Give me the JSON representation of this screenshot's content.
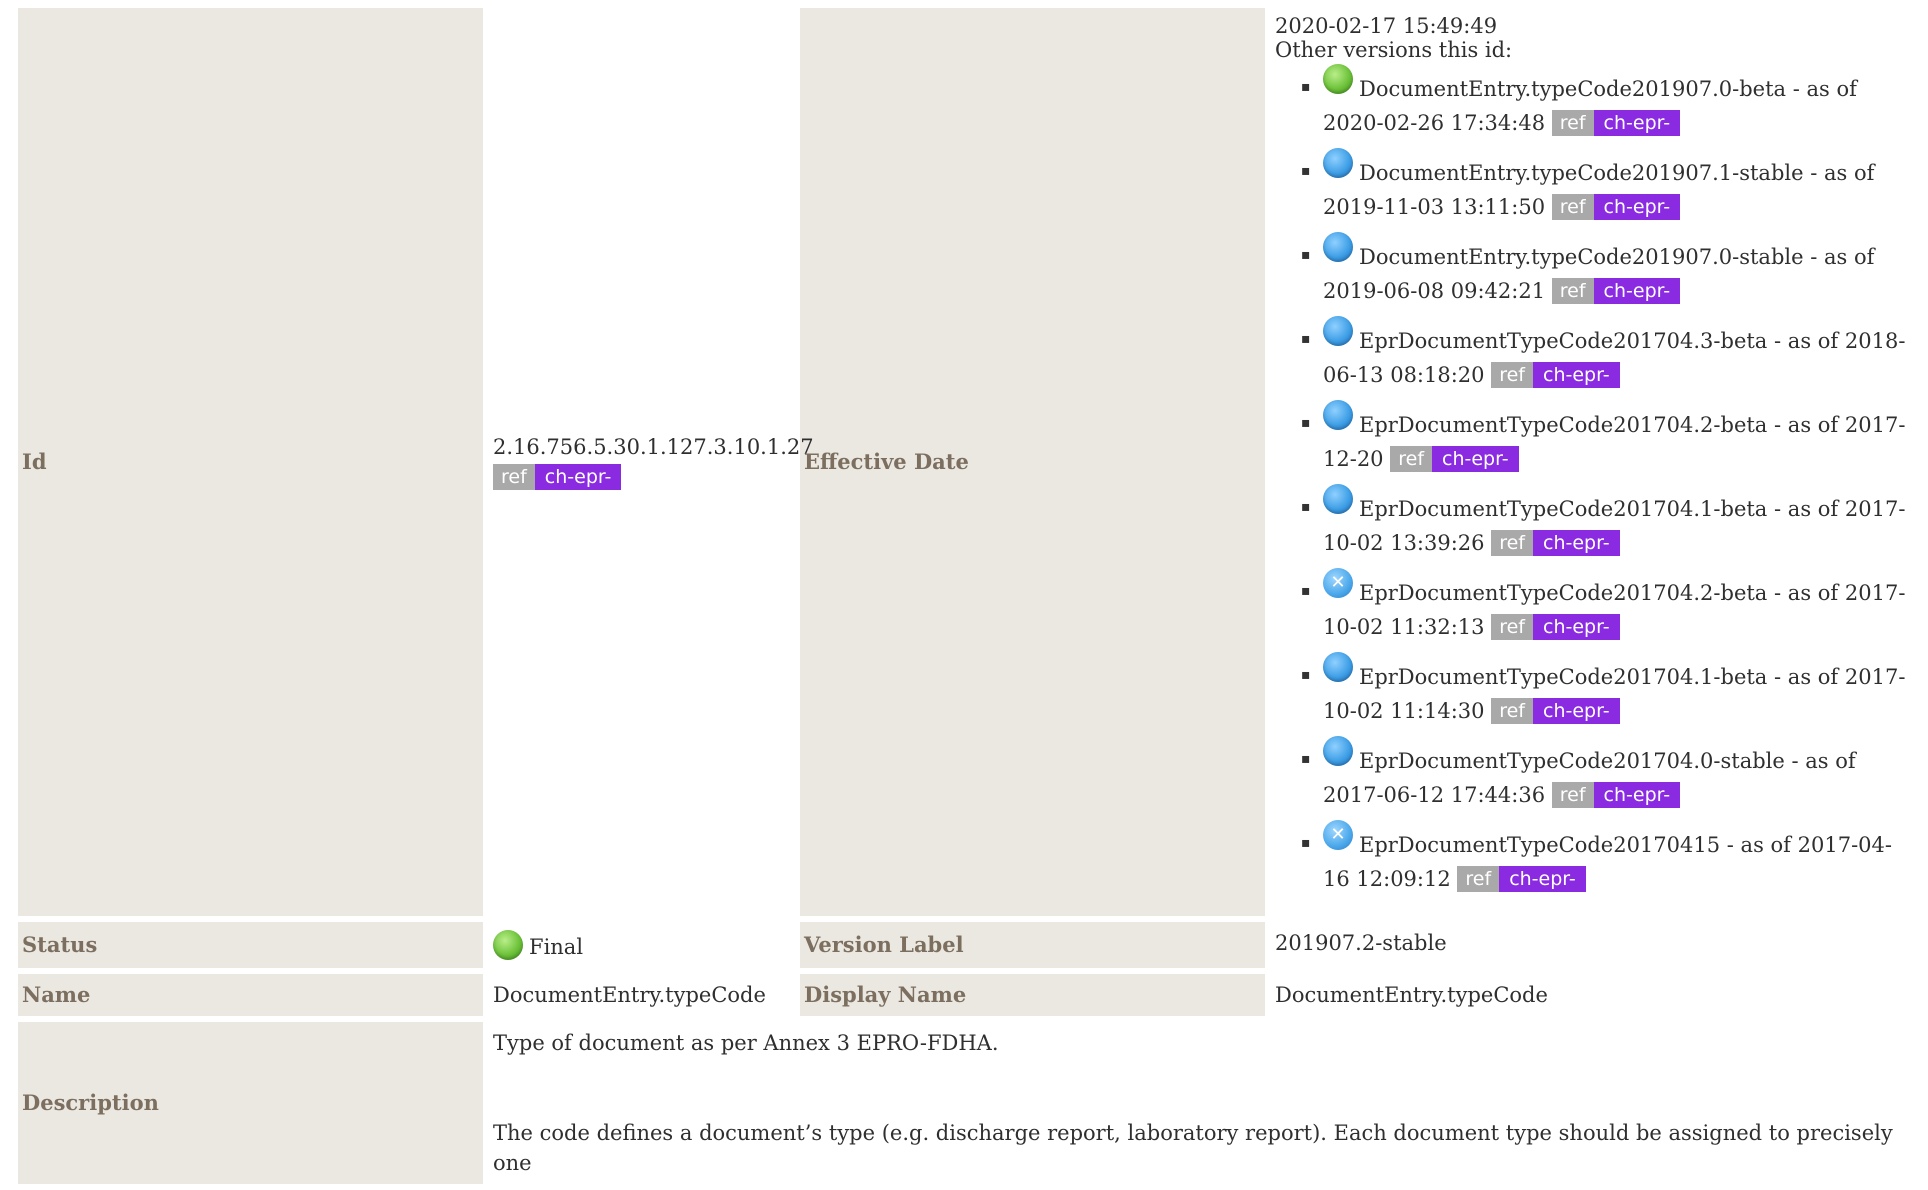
{
  "id": {
    "label": "Id",
    "value": "2.16.756.5.30.1.127.3.10.1.27",
    "ref": "ref",
    "project": "ch-epr-"
  },
  "effective_date": {
    "label": "Effective Date",
    "value": "2020-02-17 15:49:49",
    "other_versions_label": "Other versions this id:"
  },
  "versions": [
    {
      "status_icon": "green",
      "name": "DocumentEntry.typeCode201907.0-beta",
      "as_of": "as of",
      "date": "2020-02-26 17:34:48",
      "ref": "ref",
      "project": "ch-epr-"
    },
    {
      "status_icon": "blue",
      "name": "DocumentEntry.typeCode201907.1-stable",
      "as_of": "as of",
      "date": "2019-11-03 13:11:50",
      "ref": "ref",
      "project": "ch-epr-"
    },
    {
      "status_icon": "blue",
      "name": "DocumentEntry.typeCode201907.0-stable",
      "as_of": "as of",
      "date": "2019-06-08 09:42:21",
      "ref": "ref",
      "project": "ch-epr-"
    },
    {
      "status_icon": "blue",
      "name": "EprDocumentTypeCode201704.3-beta",
      "as_of": "as of",
      "date": "2018-06-13 08:18:20",
      "ref": "ref",
      "project": "ch-epr-"
    },
    {
      "status_icon": "blue",
      "name": "EprDocumentTypeCode201704.2-beta",
      "as_of": "as of",
      "date": "2017-12-20",
      "ref": "ref",
      "project": "ch-epr-"
    },
    {
      "status_icon": "blue",
      "name": "EprDocumentTypeCode201704.1-beta",
      "as_of": "as of",
      "date": "2017-10-02 13:39:26",
      "ref": "ref",
      "project": "ch-epr-"
    },
    {
      "status_icon": "cancelled",
      "name": "EprDocumentTypeCode201704.2-beta",
      "as_of": "as of",
      "date": "2017-10-02 11:32:13",
      "ref": "ref",
      "project": "ch-epr-"
    },
    {
      "status_icon": "blue",
      "name": "EprDocumentTypeCode201704.1-beta",
      "as_of": "as of",
      "date": "2017-10-02 11:14:30",
      "ref": "ref",
      "project": "ch-epr-"
    },
    {
      "status_icon": "blue",
      "name": "EprDocumentTypeCode201704.0-stable",
      "as_of": "as of",
      "date": "2017-06-12 17:44:36",
      "ref": "ref",
      "project": "ch-epr-"
    },
    {
      "status_icon": "cancelled",
      "name": "EprDocumentTypeCode20170415",
      "as_of": "as of",
      "date": "2017-04-16 12:09:12",
      "ref": "ref",
      "project": "ch-epr-"
    }
  ],
  "status": {
    "label": "Status",
    "value": "Final",
    "icon": "green"
  },
  "version_label": {
    "label": "Version Label",
    "value": "201907.2-stable"
  },
  "name": {
    "label": "Name",
    "value": "DocumentEntry.typeCode"
  },
  "display_name": {
    "label": "Display Name",
    "value": "DocumentEntry.typeCode"
  },
  "description": {
    "label": "Description",
    "paragraph1": "Type of document as per Annex 3 EPRO-FDHA.",
    "paragraph2": "The code defines a document’s type (e.g. discharge report, laboratory report). Each document type should be assigned to precisely one"
  },
  "colors": {
    "label_bg": "#ebe8e2",
    "label_text": "#7c6f5f",
    "ref_badge": "#a9a9a9",
    "project_badge": "#8a2be2"
  }
}
